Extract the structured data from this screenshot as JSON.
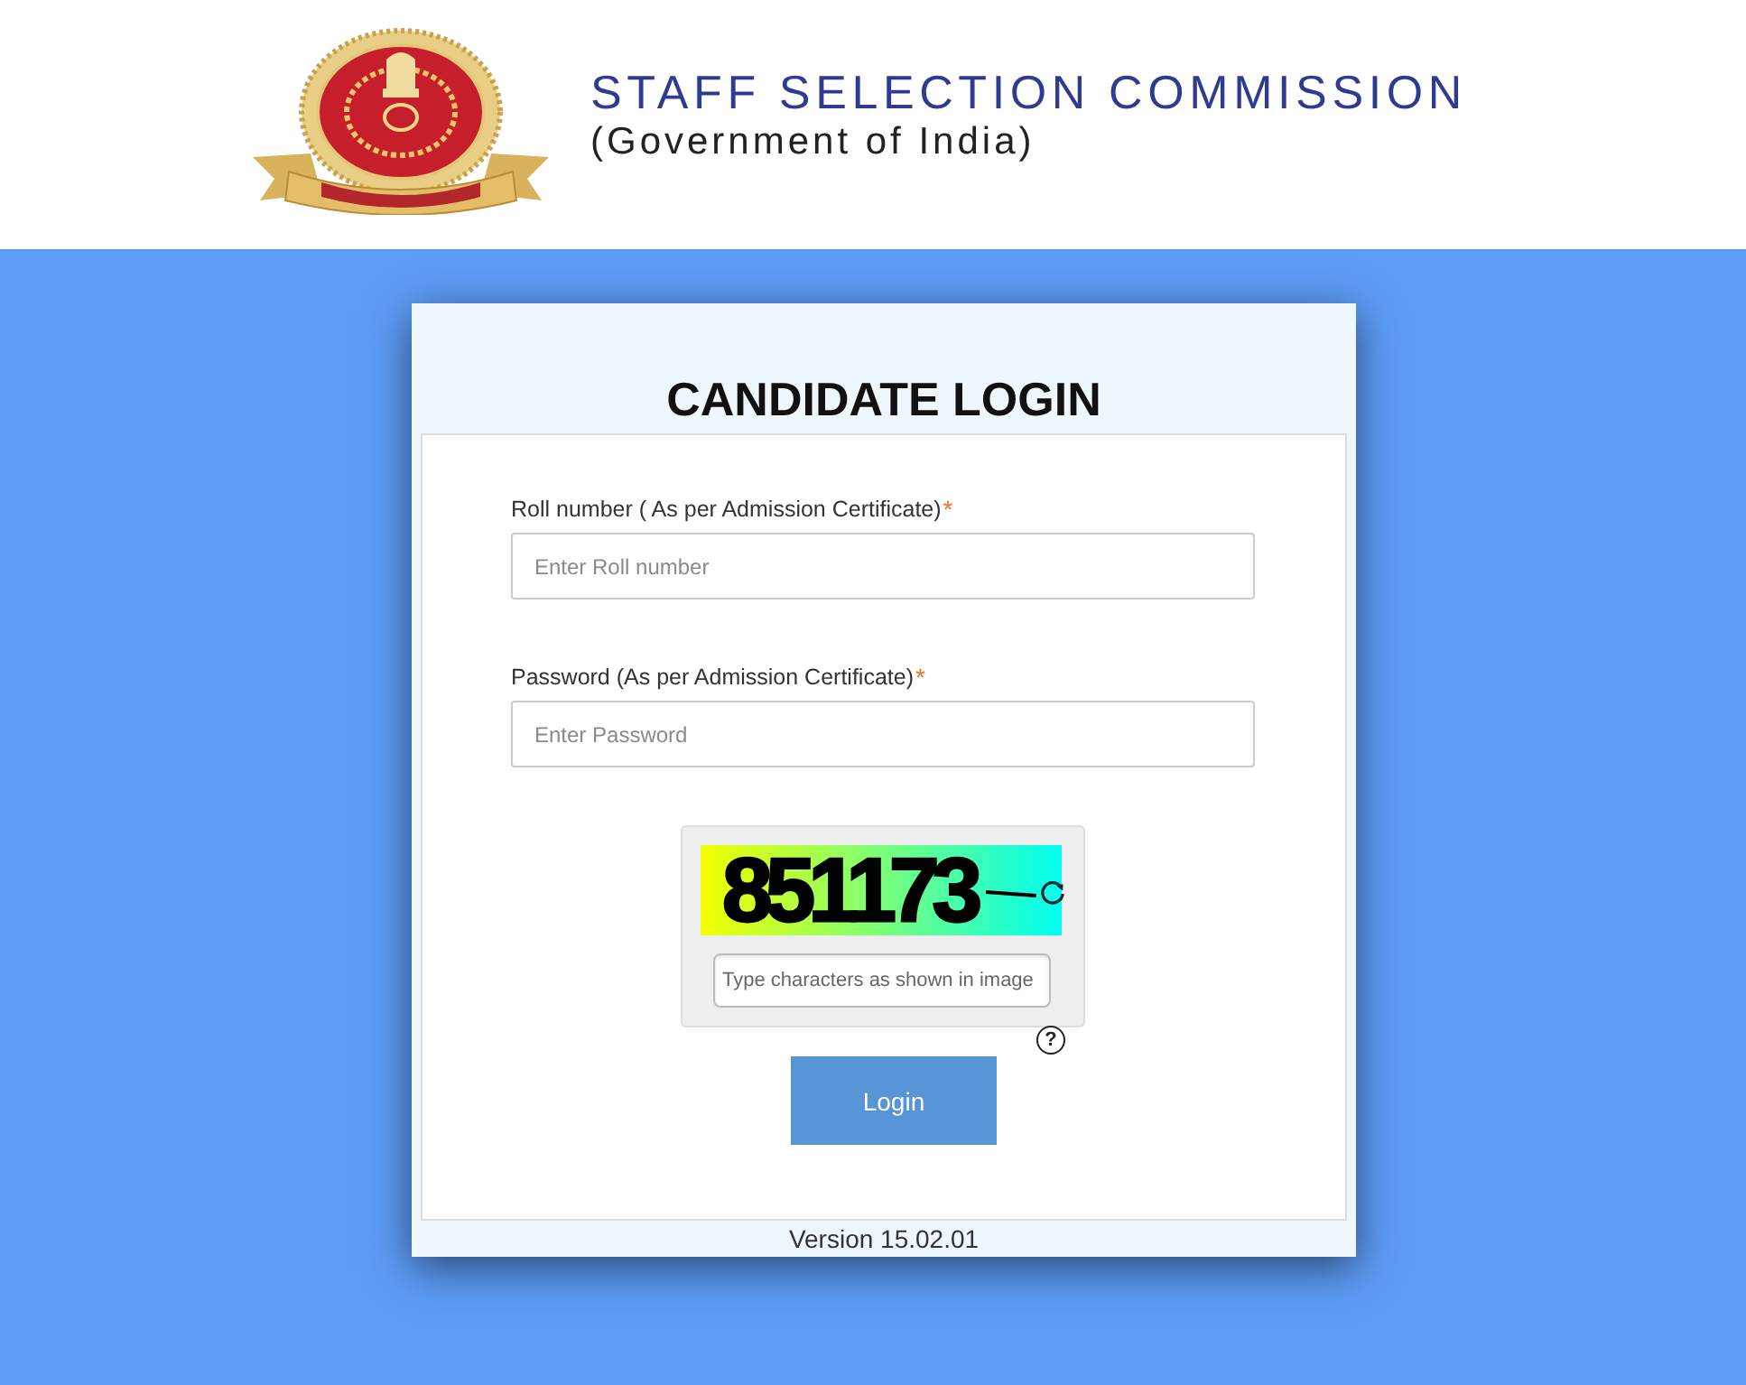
{
  "header": {
    "title": "STAFF SELECTION COMMISSION",
    "subtitle": "(Government of India)"
  },
  "login_card": {
    "title": "CANDIDATE LOGIN",
    "fields": [
      {
        "label": "Roll number ( As per Admission Certificate)",
        "required_mark": "*",
        "placeholder": "Enter Roll number"
      },
      {
        "label": "Password (As per Admission Certificate)",
        "required_mark": "*",
        "placeholder": "Enter Password"
      }
    ],
    "captcha": {
      "image_text": "851173",
      "placeholder": "Type characters as shown in image",
      "help": "?"
    },
    "login_button": "Login",
    "version": "Version 15.02.01"
  }
}
